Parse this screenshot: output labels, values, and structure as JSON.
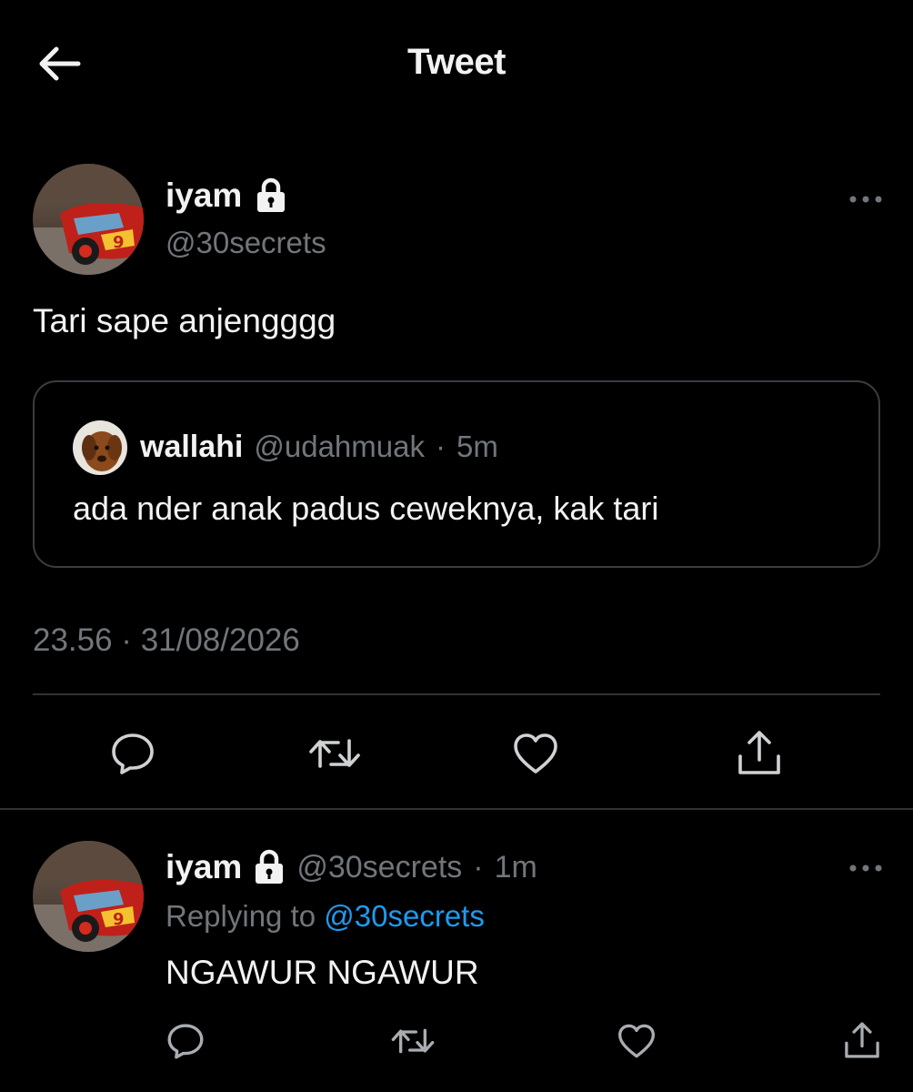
{
  "header": {
    "title": "Tweet"
  },
  "tweet": {
    "author": {
      "name": "iyam",
      "handle": "@30secrets"
    },
    "text": "Tari sape anjengggg",
    "quote": {
      "name": "wallahi",
      "handle": "@udahmuak",
      "separator": "·",
      "time": "5m",
      "text": "ada nder anak padus ceweknya, kak tari"
    },
    "timestamp": "23.56 · 31/08/2026"
  },
  "reply": {
    "author": {
      "name": "iyam",
      "handle": "@30secrets"
    },
    "separator": "·",
    "time": "1m",
    "replying_prefix": "Replying to",
    "replying_handle": "@30secrets",
    "text": "NGAWUR NGAWUR"
  },
  "icons": {
    "back": "arrow-left-icon",
    "lock": "lock-icon",
    "more": "more-horizontal-icon",
    "reply": "comment-icon",
    "retweet": "retweet-icon",
    "like": "heart-icon",
    "share": "share-icon"
  },
  "colors": {
    "background": "#000000",
    "text": "#e7e9ea",
    "secondary": "#71767b",
    "accent": "#1d9bf0",
    "border": "#2f3336"
  }
}
